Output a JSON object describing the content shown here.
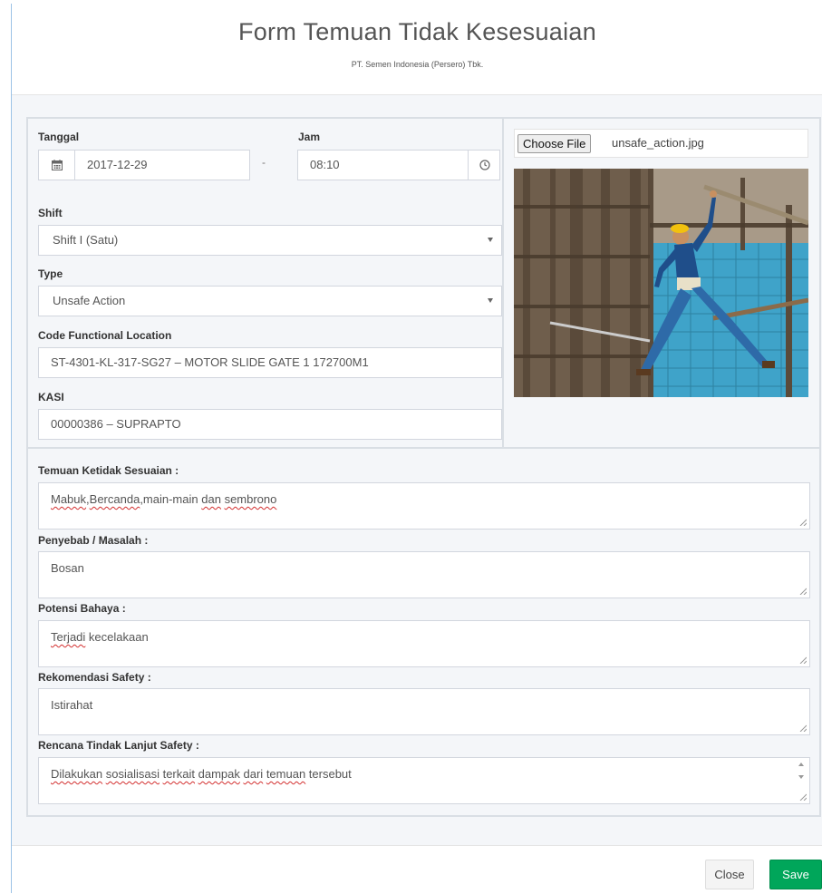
{
  "header": {
    "title": "Form Temuan Tidak Kesesuaian",
    "subtitle": "PT. Semen Indonesia (Persero) Tbk."
  },
  "form": {
    "tanggal_label": "Tanggal",
    "tanggal_value": "2017-12-29",
    "range_separator": "-",
    "jam_label": "Jam",
    "jam_value": "08:10",
    "shift_label": "Shift",
    "shift_value": "Shift I (Satu)",
    "type_label": "Type",
    "type_value": "Unsafe Action",
    "cfl_label": "Code Functional Location",
    "cfl_value": "ST-4301-KL-317-SG27 – MOTOR SLIDE GATE 1 172700M1",
    "kasi_label": "KASI",
    "kasi_value": "00000386 – SUPRAPTO"
  },
  "upload": {
    "button_label": "Choose File",
    "file_name": "unsafe_action.jpg"
  },
  "fields": {
    "temuan_label": "Temuan Ketidak Sesuaian :",
    "temuan_parts": [
      "Mabuk",
      ",",
      "Bercanda",
      ",main-main ",
      "dan",
      " ",
      "sembrono"
    ],
    "penyebab_label": "Penyebab / Masalah :",
    "penyebab_value": "Bosan",
    "potensi_label": "Potensi Bahaya :",
    "potensi_parts": [
      "Terjadi",
      " kecelakaan"
    ],
    "rekomendasi_label": "Rekomendasi Safety :",
    "rekomendasi_value": "Istirahat",
    "rencana_label": "Rencana Tindak Lanjut Safety :",
    "rencana_parts": [
      "Dilakukan",
      " ",
      "sosialisasi",
      " ",
      "terkait",
      " ",
      "dampak",
      " ",
      "dari",
      " ",
      "temuan",
      " tersebut"
    ]
  },
  "footer": {
    "close_label": "Close",
    "save_label": "Save"
  },
  "colors": {
    "save_button": "#00a65a",
    "accent_border": "#9cc3e6"
  },
  "icons": [
    "calendar-icon",
    "clock-icon",
    "chevron-down-icon",
    "resize-grip-icon",
    "spinner-arrows-icon"
  ]
}
